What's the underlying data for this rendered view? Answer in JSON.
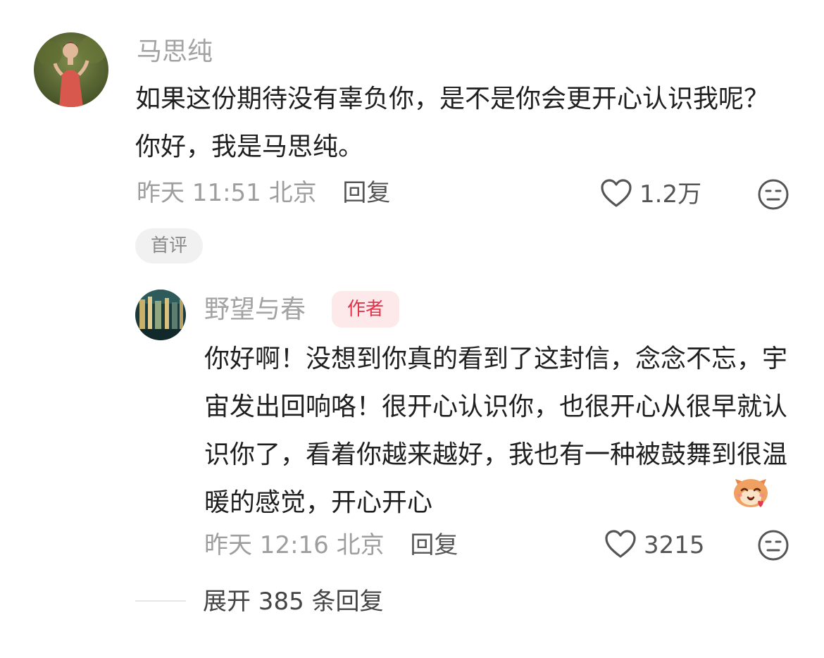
{
  "main_comment": {
    "username": "马思纯",
    "text": "如果这份期待没有辜负你，是不是你会更开心认识我呢？ 你好，我是马思纯。",
    "time": "昨天 11:51 北京",
    "reply_label": "回复",
    "likes": "1.2万",
    "badge": "首评"
  },
  "reply_comment": {
    "username": "野望与春",
    "author_badge": "作者",
    "text": "你好啊！没想到你真的看到了这封信，念念不忘，宇宙发出回响咯！很开心认识你，也很开心从很早就认识你了，看着你越来越好，我也有一种被鼓舞到很温暖的感觉，开心开心",
    "time": "昨天 12:16 北京",
    "reply_label": "回复",
    "likes": "3215"
  },
  "expand": {
    "label": "展开 385 条回复"
  },
  "icons": {
    "like": "heart-outline-icon",
    "dislike": "dislike-face-icon",
    "sticker": "cat-heart-sticker"
  },
  "colors": {
    "author_badge_bg": "#fde8ea",
    "author_badge_text": "#e0344b",
    "meta_text": "#9e9e9e"
  }
}
